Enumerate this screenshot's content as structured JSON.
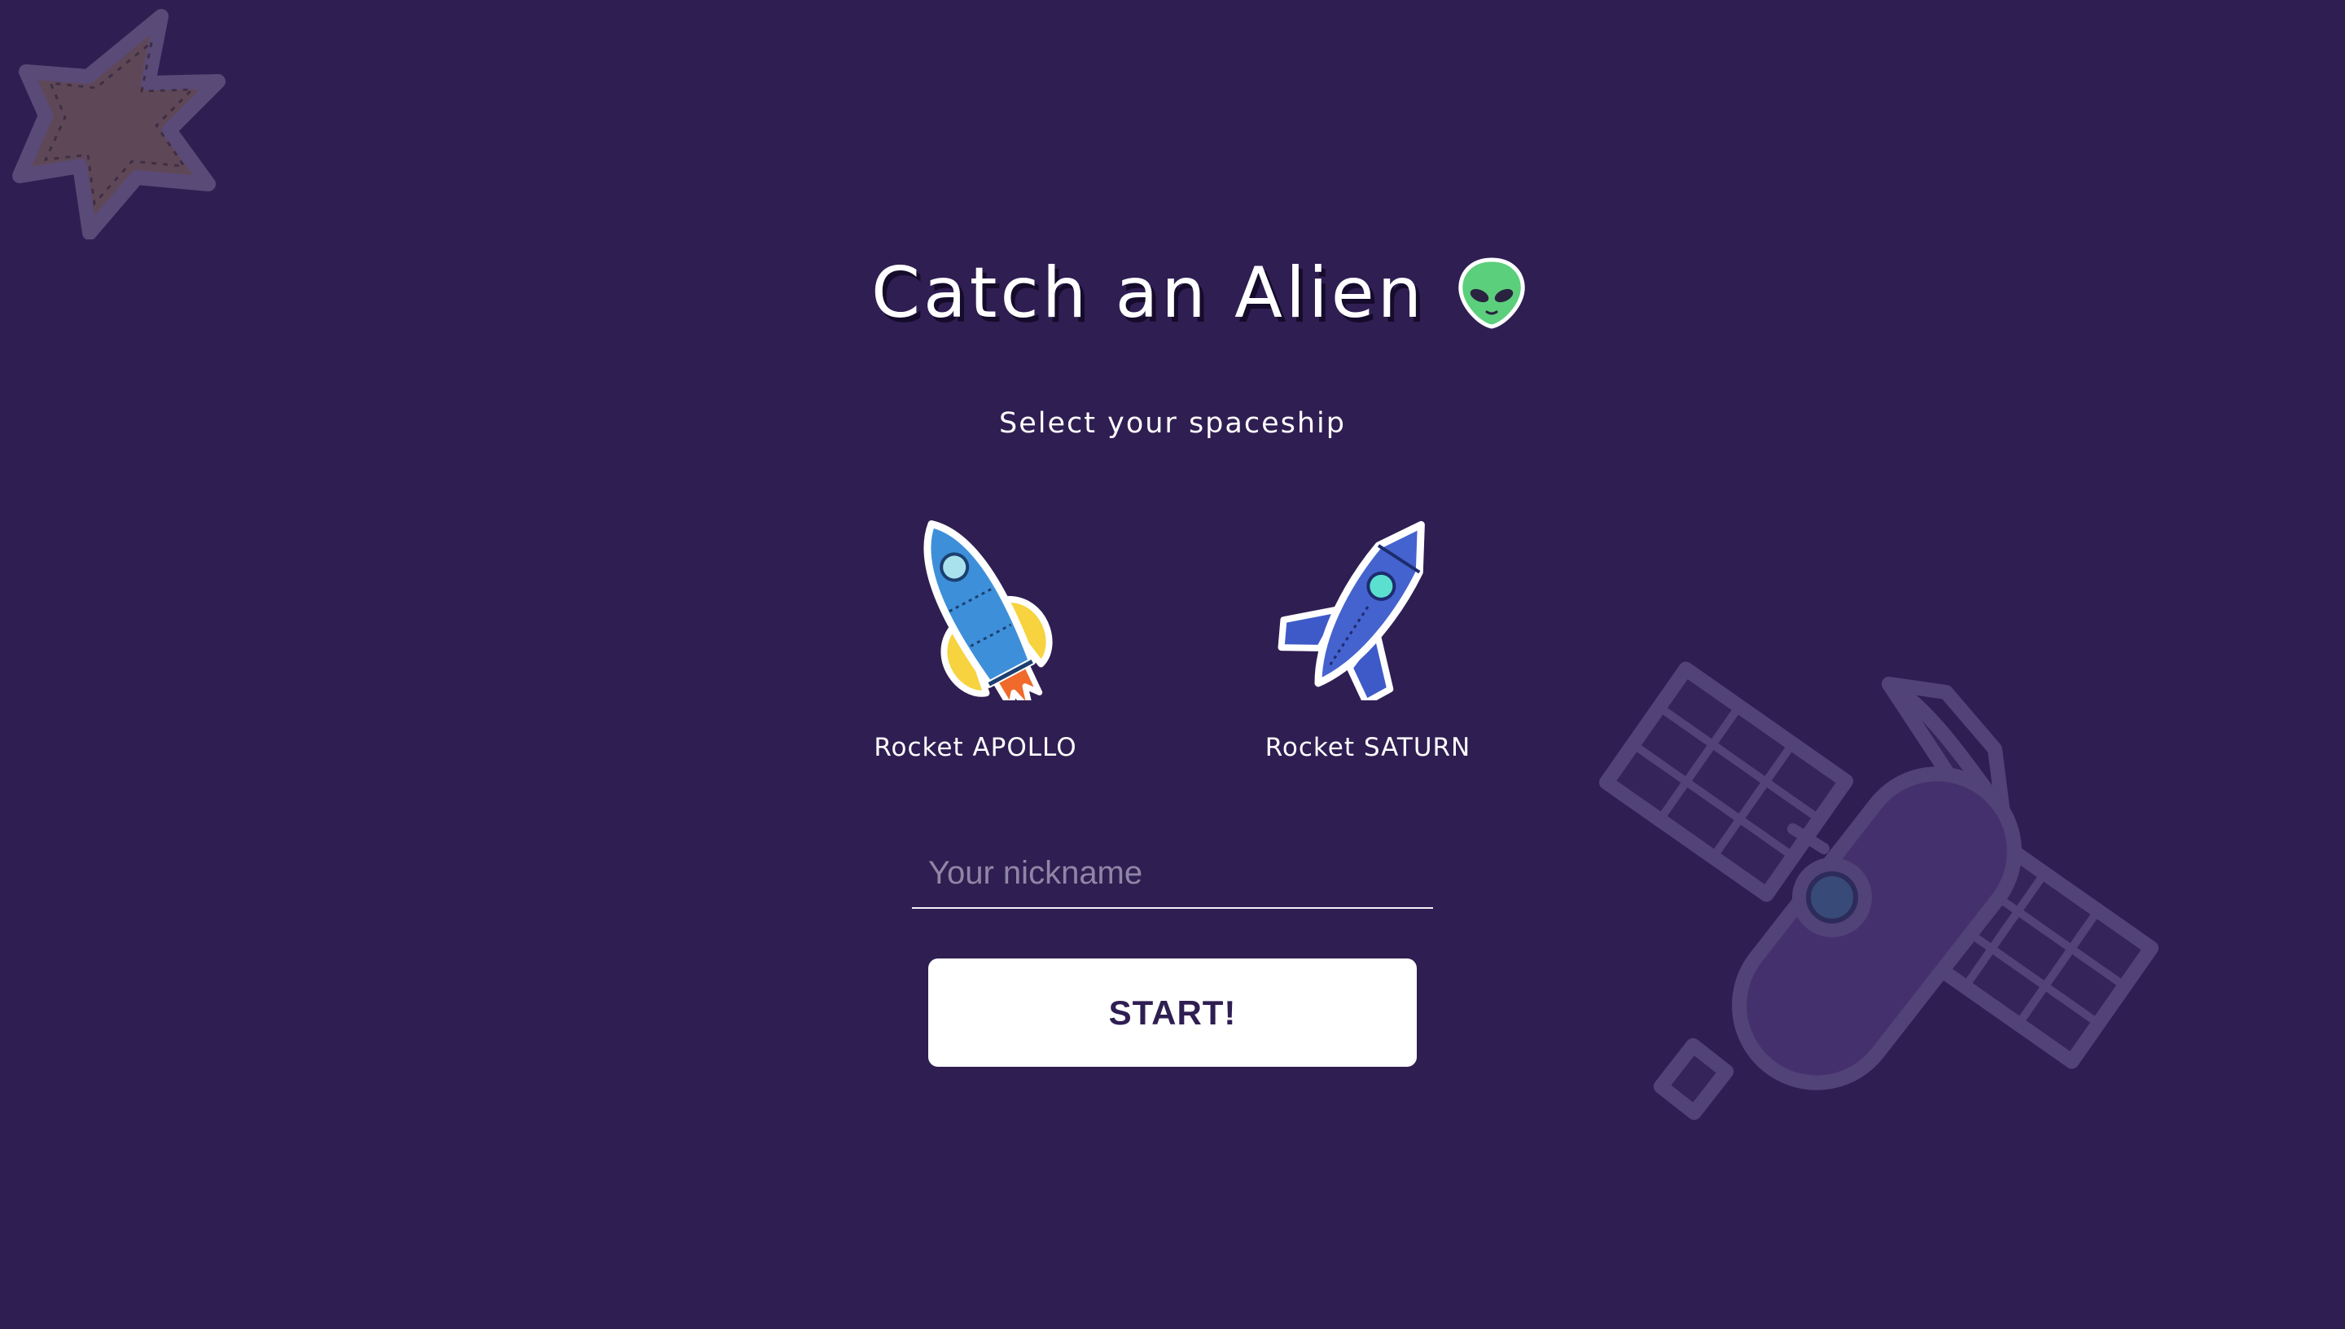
{
  "app": {
    "title": "Catch an Alien",
    "title_icon": "alien-face-icon",
    "subtitle": "Select your spaceship"
  },
  "ships": [
    {
      "label": "Rocket APOLLO",
      "icon": "rocket-apollo-icon"
    },
    {
      "label": "Rocket SATURN",
      "icon": "rocket-saturn-icon"
    }
  ],
  "form": {
    "nickname_value": "",
    "nickname_placeholder": "Your nickname",
    "start_label": "START!"
  },
  "decorations": [
    "star-icon",
    "satellite-icon"
  ],
  "colors": {
    "background": "#2f1e52",
    "button_bg": "#ffffff",
    "button_text": "#2f1e52",
    "alien_green": "#5ccf7d",
    "decor_purple": "#4f3f77"
  }
}
